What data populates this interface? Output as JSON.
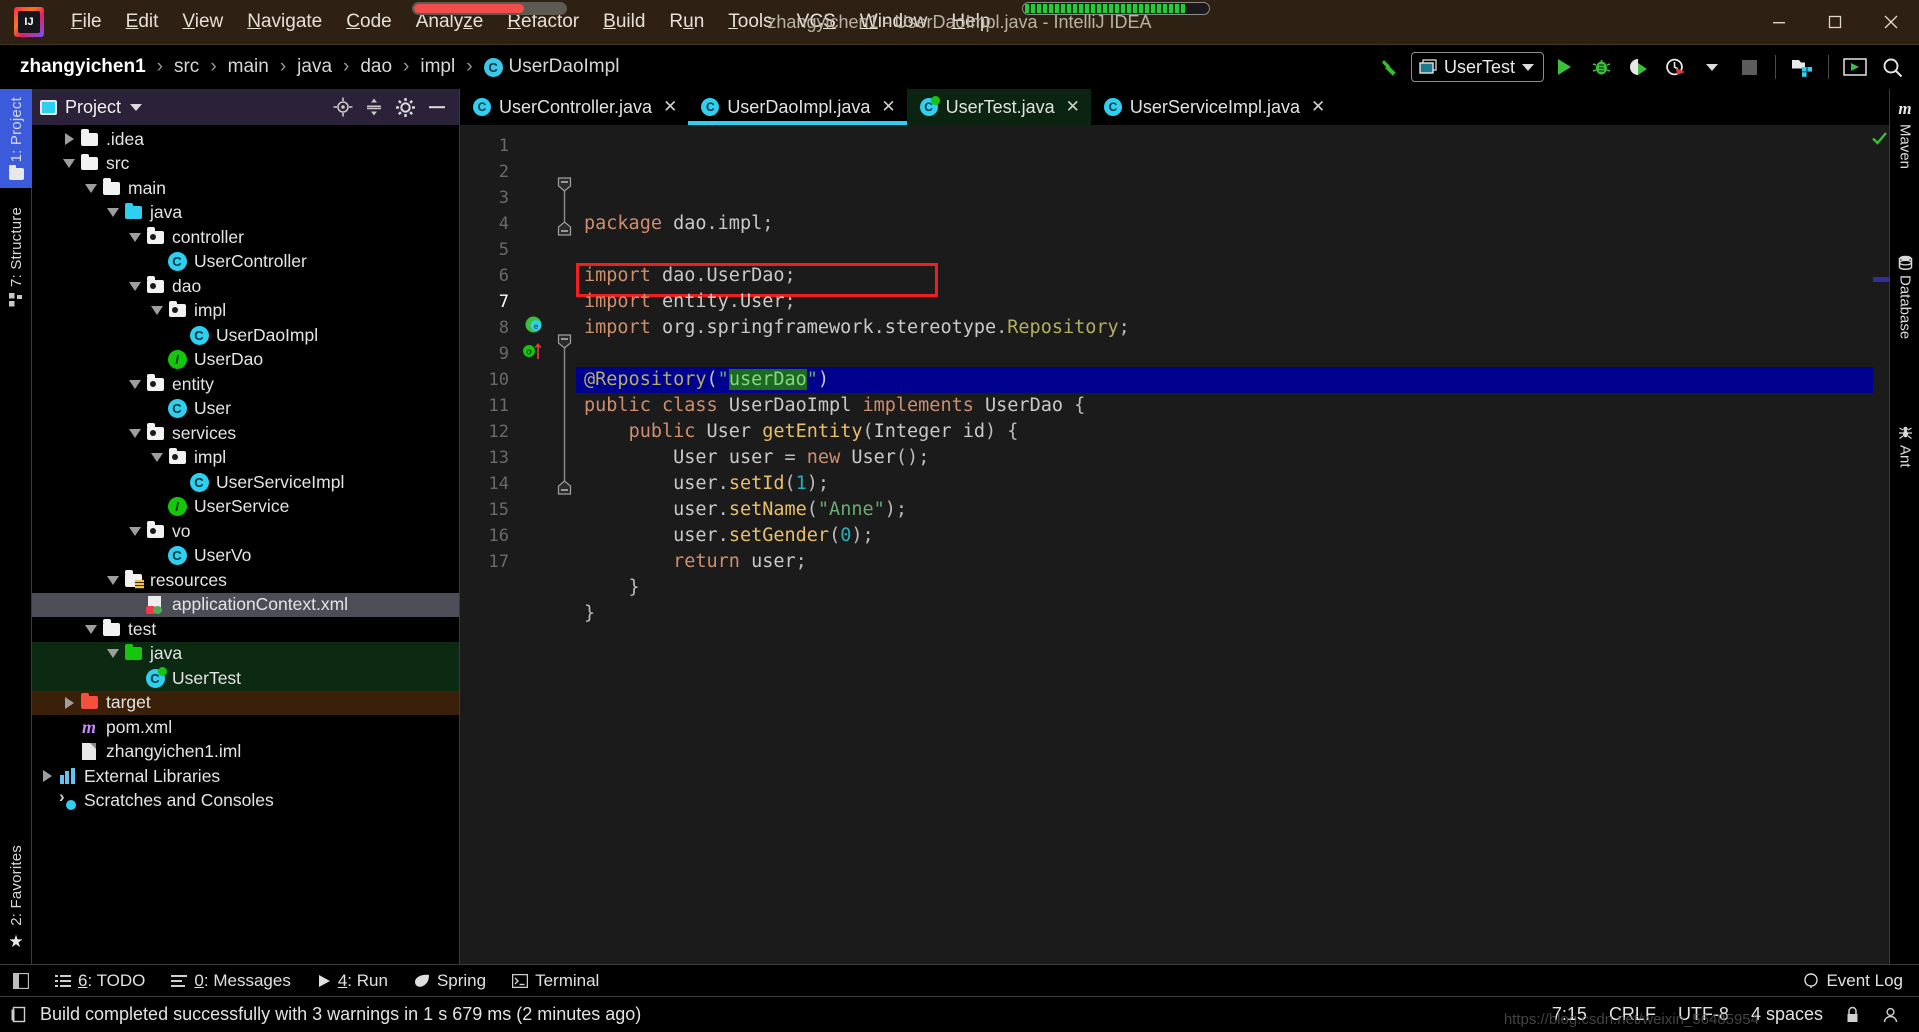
{
  "window": {
    "title": "zhangyichen1 - UserDaoImpl.java - IntelliJ IDEA",
    "minimize": "─",
    "maximize": "☐",
    "close": "✕"
  },
  "menubar": {
    "items": [
      {
        "label": "File",
        "mnemonic": "F"
      },
      {
        "label": "Edit",
        "mnemonic": "E"
      },
      {
        "label": "View",
        "mnemonic": "V"
      },
      {
        "label": "Navigate",
        "mnemonic": "N"
      },
      {
        "label": "Code",
        "mnemonic": "C"
      },
      {
        "label": "Analyze",
        "mnemonic": "z"
      },
      {
        "label": "Refactor",
        "mnemonic": "R"
      },
      {
        "label": "Build",
        "mnemonic": "B"
      },
      {
        "label": "Run",
        "mnemonic": "u"
      },
      {
        "label": "Tools",
        "mnemonic": "T"
      },
      {
        "label": "VCS",
        "mnemonic": "S"
      },
      {
        "label": "Window",
        "mnemonic": "W"
      },
      {
        "label": "Help",
        "mnemonic": "H"
      }
    ]
  },
  "navbar": {
    "breadcrumbs": [
      "zhangyichen1",
      "src",
      "main",
      "java",
      "dao",
      "impl",
      "UserDaoImpl"
    ],
    "separator": "›",
    "class_badge": "C",
    "run_config": "UserTest",
    "icons": [
      "build-hammer-icon",
      "run-icon",
      "debug-icon",
      "run-with-coverage-icon",
      "profile-icon",
      "stop-icon",
      "project-structure-icon",
      "update-app-icon",
      "search-everywhere-icon"
    ]
  },
  "left_strip": {
    "tabs": [
      {
        "label": "1: Project",
        "active": true
      },
      {
        "label": "7: Structure",
        "active": false
      }
    ],
    "bottom_tab": {
      "label": "2: Favorites"
    }
  },
  "right_strip": {
    "tabs": [
      {
        "label": "Maven",
        "icon": "maven-icon"
      },
      {
        "label": "Database",
        "icon": "database-icon"
      },
      {
        "label": "Ant",
        "icon": "ant-icon"
      }
    ]
  },
  "project_panel": {
    "title": "Project",
    "actions": [
      "locate-icon",
      "collapse-all-icon",
      "settings-gear-icon",
      "hide-icon"
    ],
    "tree": [
      {
        "label": ".idea",
        "indent": 1,
        "toggle": "closed",
        "icon": "folder",
        "state": "normal"
      },
      {
        "label": "src",
        "indent": 1,
        "toggle": "open",
        "icon": "folder",
        "state": "normal"
      },
      {
        "label": "main",
        "indent": 2,
        "toggle": "open",
        "icon": "folder",
        "state": "normal"
      },
      {
        "label": "java",
        "indent": 3,
        "toggle": "open",
        "icon": "folder-cyan",
        "state": "normal"
      },
      {
        "label": "controller",
        "indent": 4,
        "toggle": "open",
        "icon": "package",
        "state": "normal"
      },
      {
        "label": "UserController",
        "indent": 5,
        "toggle": "none",
        "icon": "class",
        "state": "normal"
      },
      {
        "label": "dao",
        "indent": 4,
        "toggle": "open",
        "icon": "package",
        "state": "normal"
      },
      {
        "label": "impl",
        "indent": 5,
        "toggle": "open",
        "icon": "package",
        "state": "normal"
      },
      {
        "label": "UserDaoImpl",
        "indent": 6,
        "toggle": "none",
        "icon": "class",
        "state": "normal"
      },
      {
        "label": "UserDao",
        "indent": 5,
        "toggle": "none",
        "icon": "interface",
        "state": "normal"
      },
      {
        "label": "entity",
        "indent": 4,
        "toggle": "open",
        "icon": "package",
        "state": "normal"
      },
      {
        "label": "User",
        "indent": 5,
        "toggle": "none",
        "icon": "class",
        "state": "normal"
      },
      {
        "label": "services",
        "indent": 4,
        "toggle": "open",
        "icon": "package",
        "state": "normal"
      },
      {
        "label": "impl",
        "indent": 5,
        "toggle": "open",
        "icon": "package",
        "state": "normal"
      },
      {
        "label": "UserServiceImpl",
        "indent": 6,
        "toggle": "none",
        "icon": "class",
        "state": "normal"
      },
      {
        "label": "UserService",
        "indent": 5,
        "toggle": "none",
        "icon": "interface",
        "state": "normal"
      },
      {
        "label": "vo",
        "indent": 4,
        "toggle": "open",
        "icon": "package",
        "state": "normal"
      },
      {
        "label": "UserVo",
        "indent": 5,
        "toggle": "none",
        "icon": "class",
        "state": "normal"
      },
      {
        "label": "resources",
        "indent": 3,
        "toggle": "open",
        "icon": "resources",
        "state": "normal"
      },
      {
        "label": "applicationContext.xml",
        "indent": 4,
        "toggle": "none",
        "icon": "xml-spring",
        "state": "selected"
      },
      {
        "label": "test",
        "indent": 2,
        "toggle": "open",
        "icon": "folder",
        "state": "normal"
      },
      {
        "label": "java",
        "indent": 3,
        "toggle": "open",
        "icon": "folder-green",
        "state": "green"
      },
      {
        "label": "UserTest",
        "indent": 4,
        "toggle": "none",
        "icon": "class-test",
        "state": "green"
      },
      {
        "label": "target",
        "indent": 1,
        "toggle": "closed",
        "icon": "folder-red",
        "state": "brown"
      },
      {
        "label": "pom.xml",
        "indent": 1,
        "toggle": "none",
        "icon": "maven-m",
        "state": "normal"
      },
      {
        "label": "zhangyichen1.iml",
        "indent": 1,
        "toggle": "none",
        "icon": "iml",
        "state": "normal"
      },
      {
        "label": "External Libraries",
        "indent": 0,
        "toggle": "closed",
        "icon": "libraries",
        "state": "normal"
      },
      {
        "label": "Scratches and Consoles",
        "indent": 0,
        "toggle": "none",
        "icon": "scratches",
        "state": "normal"
      }
    ]
  },
  "editor": {
    "tabs": [
      {
        "label": "UserController.java",
        "active": false,
        "icon": "class",
        "green": false
      },
      {
        "label": "UserDaoImpl.java",
        "active": true,
        "icon": "class",
        "green": false
      },
      {
        "label": "UserTest.java",
        "active": false,
        "icon": "class-test",
        "green": true
      },
      {
        "label": "UserServiceImpl.java",
        "active": false,
        "icon": "class",
        "green": false
      }
    ],
    "close_glyph": "✕",
    "first_line": 1,
    "last_line": 17,
    "highlighted_line": 7,
    "selection_text": "userDao",
    "lines": [
      {
        "n": 1,
        "text": "package dao.impl;"
      },
      {
        "n": 2,
        "text": ""
      },
      {
        "n": 3,
        "text": "import dao.UserDao;"
      },
      {
        "n": 4,
        "text": "import entity.User;"
      },
      {
        "n": 5,
        "text": "import org.springframework.stereotype.Repository;"
      },
      {
        "n": 6,
        "text": ""
      },
      {
        "n": 7,
        "text": "@Repository(\"userDao\")"
      },
      {
        "n": 8,
        "text": "public class UserDaoImpl implements UserDao {"
      },
      {
        "n": 9,
        "text": "    public User getEntity(Integer id) {"
      },
      {
        "n": 10,
        "text": "        User user = new User();"
      },
      {
        "n": 11,
        "text": "        user.setId(1);"
      },
      {
        "n": 12,
        "text": "        user.setName(\"Anne\");"
      },
      {
        "n": 13,
        "text": "        user.setGender(0);"
      },
      {
        "n": 14,
        "text": "        return user;"
      },
      {
        "n": 15,
        "text": "    }"
      },
      {
        "n": 16,
        "text": "}"
      },
      {
        "n": 17,
        "text": ""
      }
    ],
    "gutter_marks": [
      {
        "line": 8,
        "icon": "spring-bean-icon"
      },
      {
        "line": 9,
        "icon": "implementing-method-icon"
      }
    ],
    "inspection_status": "ok-check-icon"
  },
  "tool_window_bar": {
    "buttons": [
      {
        "label": "6: TODO",
        "mnemonic": "6",
        "icon": "todo-icon"
      },
      {
        "label": "0: Messages",
        "mnemonic": "0",
        "icon": "messages-icon"
      },
      {
        "label": "4: Run",
        "mnemonic": "4",
        "icon": "run-icon"
      },
      {
        "label": "Spring",
        "mnemonic": "",
        "icon": "spring-leaf-icon"
      },
      {
        "label": "Terminal",
        "mnemonic": "",
        "icon": "terminal-icon"
      }
    ],
    "event_log": "Event Log"
  },
  "statusbar": {
    "message": "Build completed successfully with 3 warnings in 1 s 679 ms (2 minutes ago)",
    "caret_position": "7:15",
    "line_separator": "CRLF",
    "encoding": "UTF-8",
    "indent": "4 spaces",
    "watermark": "https://blog.csdn.net/weixin_56485954"
  },
  "colors": {
    "titlebar_bg": "#2e2013",
    "accent_cyan": "#2fd0ef",
    "accent_green": "#16c60c",
    "selection_blue": "#00008f",
    "annotation_red": "#f01e1e",
    "keyword_orange": "#cf8e6d",
    "string_green": "#6aab73",
    "annotation_yellow": "#b3ae60",
    "method_yellow": "#e8bf6a",
    "number_cyan": "#2aacb8",
    "project_header_bg": "#2b2139"
  }
}
